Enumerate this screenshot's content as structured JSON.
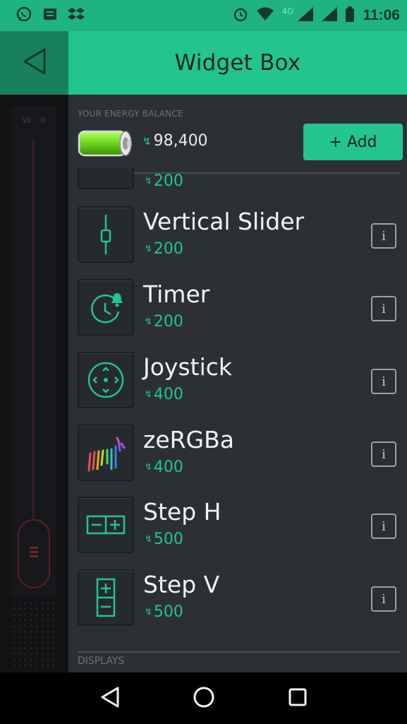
{
  "status_bar": {
    "time": "11:06",
    "network": "4G",
    "icons": [
      "whatsapp-icon",
      "message-icon",
      "dropbox-icon",
      "alarm-icon",
      "wifi-icon",
      "signal-icon",
      "signal-icon",
      "battery-icon"
    ]
  },
  "header": {
    "title": "Widget Box",
    "back_icon": "back-triangle-icon"
  },
  "left_panel": {
    "slider_label": "V6: 0"
  },
  "energy": {
    "label": "YOUR ENERGY BALANCE",
    "value": "98,400",
    "add_label": "+ Add"
  },
  "partial_item": {
    "price": "200"
  },
  "widgets": [
    {
      "name": "Vertical Slider",
      "price": "200",
      "icon": "vertical-slider-icon"
    },
    {
      "name": "Timer",
      "price": "200",
      "icon": "timer-icon"
    },
    {
      "name": "Joystick",
      "price": "400",
      "icon": "joystick-icon"
    },
    {
      "name": "zeRGBa",
      "price": "400",
      "icon": "zebra-icon"
    },
    {
      "name": "Step H",
      "price": "500",
      "icon": "step-h-icon"
    },
    {
      "name": "Step V",
      "price": "500",
      "icon": "step-v-icon"
    }
  ],
  "info_label": "i",
  "section_displays": "DISPLAYS",
  "colors": {
    "accent": "#23c48e",
    "header_dark": "#19805f",
    "background": "#2c3035"
  }
}
